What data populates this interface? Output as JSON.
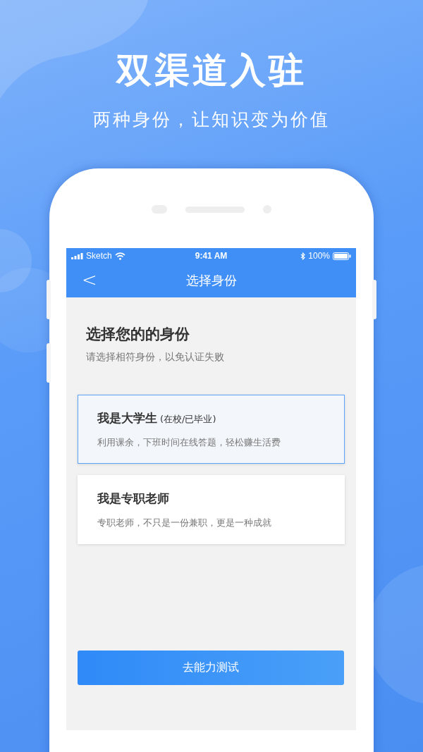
{
  "headline": "双渠道入驻",
  "tagline": "两种身份，让知识变为价值",
  "status_bar": {
    "carrier": "Sketch",
    "time": "9:41 AM",
    "battery": "100%"
  },
  "nav": {
    "back": "<",
    "title": "选择身份"
  },
  "heading": "选择您的的身份",
  "subheading": "请选择相符身份，以免认证失败",
  "options": [
    {
      "title": "我是大学生",
      "note": "(在校/已毕业)",
      "desc": "利用课余，下班时间在线答题，轻松赚生活费",
      "selected": true
    },
    {
      "title": "我是专职老师",
      "desc": "专职老师，不只是一份兼职，更是一种成就",
      "selected": false
    }
  ],
  "action": "去能力测试"
}
